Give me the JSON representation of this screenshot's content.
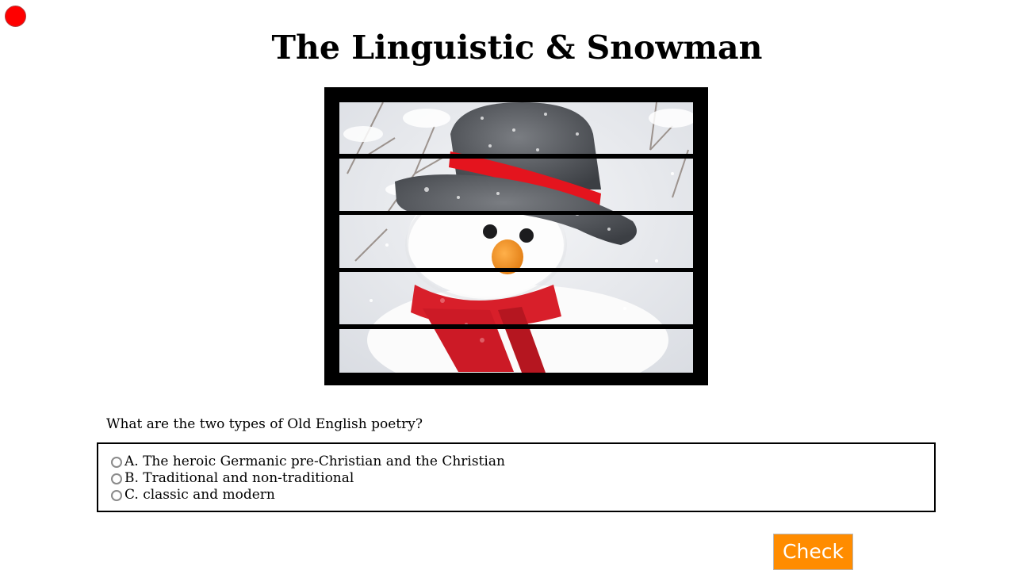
{
  "title": "The Linguistic & Snowman",
  "status_indicator": {
    "color": "#ff0000"
  },
  "puzzle": {
    "image_subject": "snowman with grey top hat, red band, orange carrot nose and red scarf in snow",
    "strip_count": 5
  },
  "quiz": {
    "question": "What are the two types of Old English poetry?",
    "options": [
      {
        "label": "A. The heroic Germanic pre-Christian and the Christian"
      },
      {
        "label": "B. Traditional and non-traditional"
      },
      {
        "label": "C. classic and modern"
      }
    ],
    "check_label": "Check"
  },
  "colors": {
    "accent": "#ff8c00",
    "frame": "#000000"
  }
}
